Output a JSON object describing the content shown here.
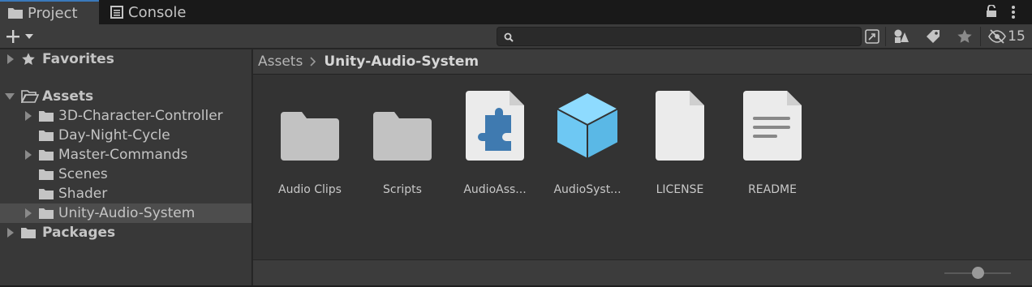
{
  "tabs": [
    {
      "label": "Project",
      "icon": "folder-icon",
      "active": true
    },
    {
      "label": "Console",
      "icon": "console-icon",
      "active": false
    }
  ],
  "toolbar": {
    "search_value": "",
    "hidden_count": "15"
  },
  "tree": {
    "favorites": "Favorites",
    "assets": "Assets",
    "children": [
      "3D-Character-Controller",
      "Day-Night-Cycle",
      "Master-Commands",
      "Scenes",
      "Shader",
      "Unity-Audio-System"
    ],
    "packages": "Packages"
  },
  "breadcrumb": {
    "root": "Assets",
    "current": "Unity-Audio-System"
  },
  "assets": [
    {
      "name": "Audio Clips",
      "type": "folder"
    },
    {
      "name": "Scripts",
      "type": "folder"
    },
    {
      "name": "AudioAss...",
      "type": "assembly-definition"
    },
    {
      "name": "AudioSyst...",
      "type": "prefab"
    },
    {
      "name": "LICENSE",
      "type": "file"
    },
    {
      "name": "README",
      "type": "text-file"
    }
  ],
  "zoom": {
    "value": 0.5
  },
  "colors": {
    "accent": "#3a79bb",
    "selected_row": "#4d4d4d",
    "prefab": "#6ec8f3",
    "assembly": "#3f7ab0"
  }
}
